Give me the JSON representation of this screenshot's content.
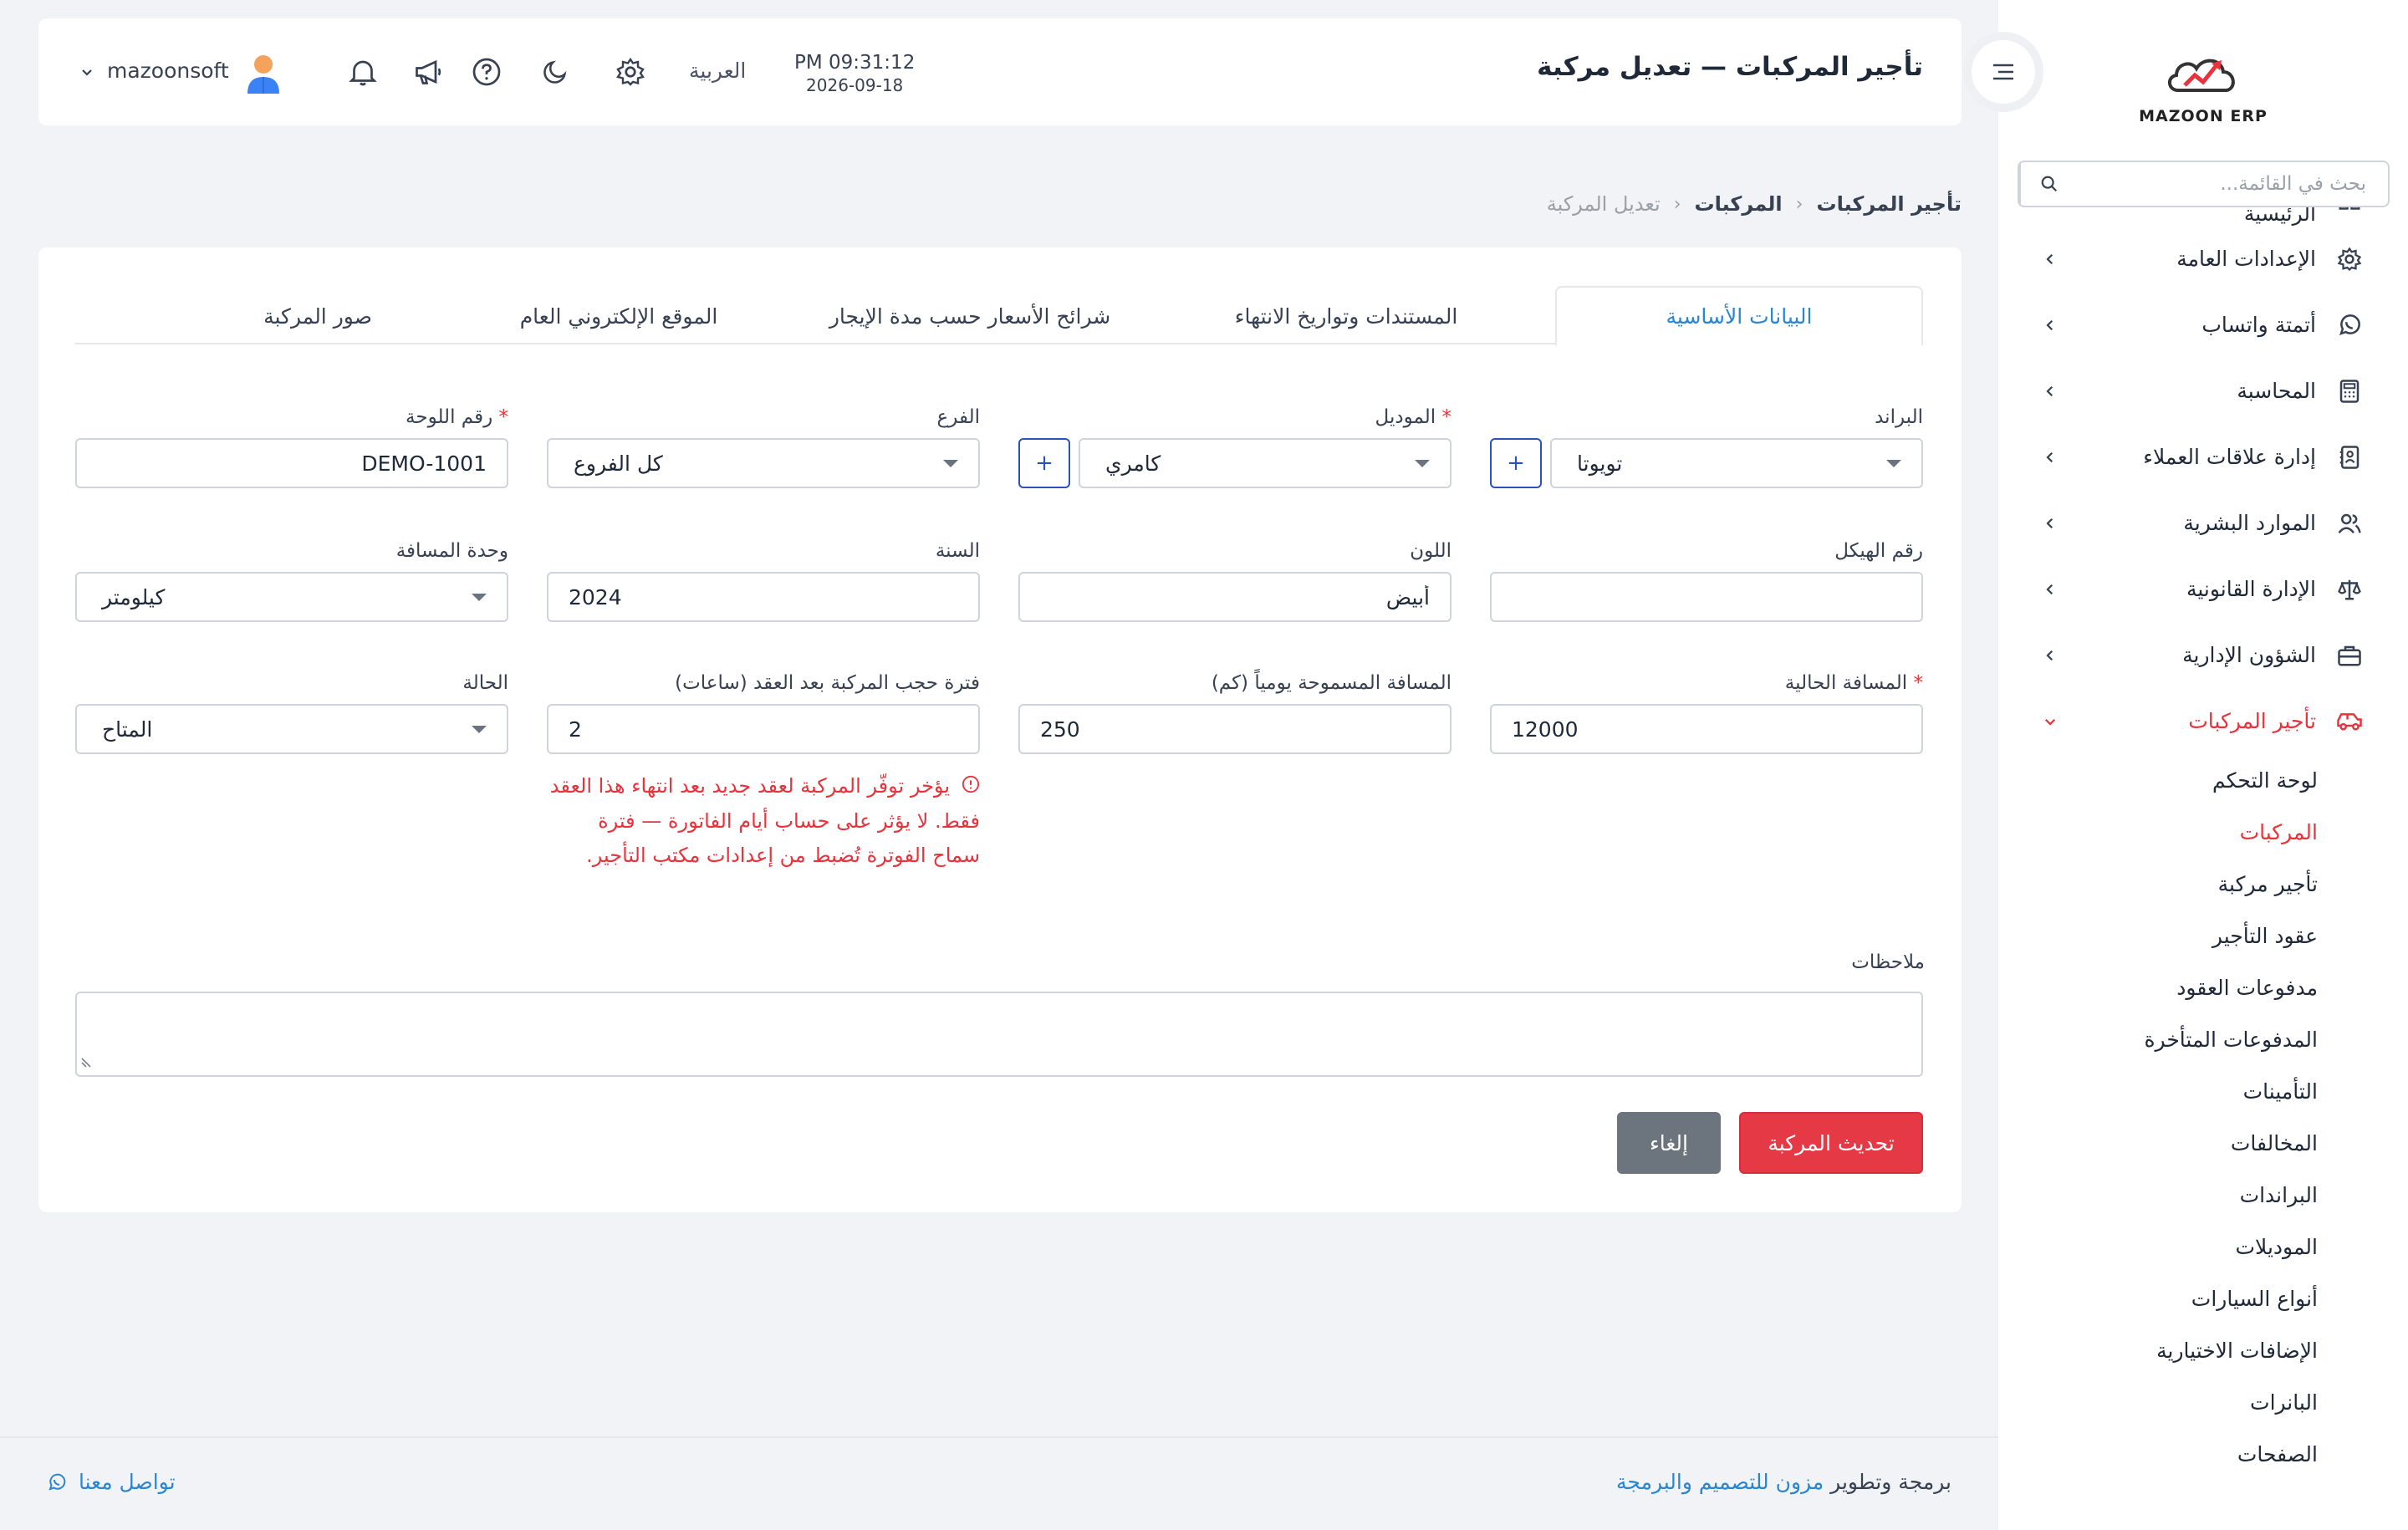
{
  "app": {
    "logo_text": "MAZOON ERP",
    "page_title": "تأجير المركبات — تعديل مركبة"
  },
  "sidebar": {
    "search_placeholder": "بحث في القائمة...",
    "partial_item": "الرئيسية",
    "items": [
      {
        "label": "الإعدادات العامة",
        "icon": "gear-icon"
      },
      {
        "label": "أتمتة واتساب",
        "icon": "whatsapp-icon"
      },
      {
        "label": "المحاسبة",
        "icon": "calculator-icon"
      },
      {
        "label": "إدارة علاقات العملاء",
        "icon": "contact-card-icon"
      },
      {
        "label": "الموارد البشرية",
        "icon": "users-icon"
      },
      {
        "label": "الإدارة القانونية",
        "icon": "scale-icon"
      },
      {
        "label": "الشؤون الإدارية",
        "icon": "briefcase-icon"
      },
      {
        "label": "تأجير المركبات",
        "icon": "car-icon",
        "active": true
      }
    ],
    "sub_items": [
      "لوحة التحكم",
      "المركبات",
      "تأجير مركبة",
      "عقود التأجير",
      "مدفوعات العقود",
      "المدفوعات المتأخرة",
      "التأمينات",
      "المخالفات",
      "البراندات",
      "الموديلات",
      "أنواع السيارات",
      "الإضافات الاختيارية",
      "البانرات",
      "الصفحات"
    ],
    "active_sub": "المركبات"
  },
  "header": {
    "time": "PM 09:31:12",
    "date": "2026-09-18",
    "language": "العربية",
    "username": "mazoonsoft"
  },
  "breadcrumb": {
    "level1": "تأجير المركبات",
    "level2": "المركبات",
    "level3": "تعديل المركبة"
  },
  "tabs": [
    {
      "label": "البيانات الأساسية",
      "active": true
    },
    {
      "label": "المستندات وتواريخ الانتهاء"
    },
    {
      "label": "شرائح الأسعار حسب مدة الإيجار"
    },
    {
      "label": "الموقع الإلكتروني العام"
    },
    {
      "label": "صور المركبة"
    }
  ],
  "form": {
    "brand": {
      "label": "البراند",
      "value": "تويوتا"
    },
    "model": {
      "label": "الموديل",
      "value": "كامري",
      "required": "*"
    },
    "branch": {
      "label": "الفرع",
      "value": "كل الفروع"
    },
    "plate": {
      "label": "رقم اللوحة",
      "value": "DEMO-1001",
      "required": "*"
    },
    "chassis": {
      "label": "رقم الهيكل",
      "value": ""
    },
    "color": {
      "label": "اللون",
      "value": "أبيض"
    },
    "year": {
      "label": "السنة",
      "value": "2024"
    },
    "distance_unit": {
      "label": "وحدة المسافة",
      "value": "كيلومتر"
    },
    "current_mileage": {
      "label": "المسافة الحالية",
      "value": "12000",
      "required": "*"
    },
    "daily_allowance": {
      "label": "المسافة المسموحة يومياً (كم)",
      "value": "250"
    },
    "hold_period": {
      "label": "فترة حجب المركبة بعد العقد (ساعات)",
      "value": "2"
    },
    "status": {
      "label": "الحالة",
      "value": "المتاح"
    },
    "hold_hint": "يؤخر توفّر المركبة لعقد جديد بعد انتهاء هذا العقد فقط. لا يؤثر على حساب أيام الفاتورة — فترة سماح الفوترة تُضبط من إعدادات مكتب التأجير.",
    "notes": {
      "label": "ملاحظات",
      "value": ""
    },
    "plus_label": "+",
    "submit_label": "تحديث المركبة",
    "cancel_label": "إلغاء"
  },
  "footer": {
    "credit_prefix": "برمجة وتطوير",
    "credit_link": "مزون للتصميم والبرمجة",
    "contact": "تواصل معنا"
  },
  "colors": {
    "accent": "#e8333c",
    "link": "#2a86d1",
    "plus_border": "#2a52be"
  }
}
